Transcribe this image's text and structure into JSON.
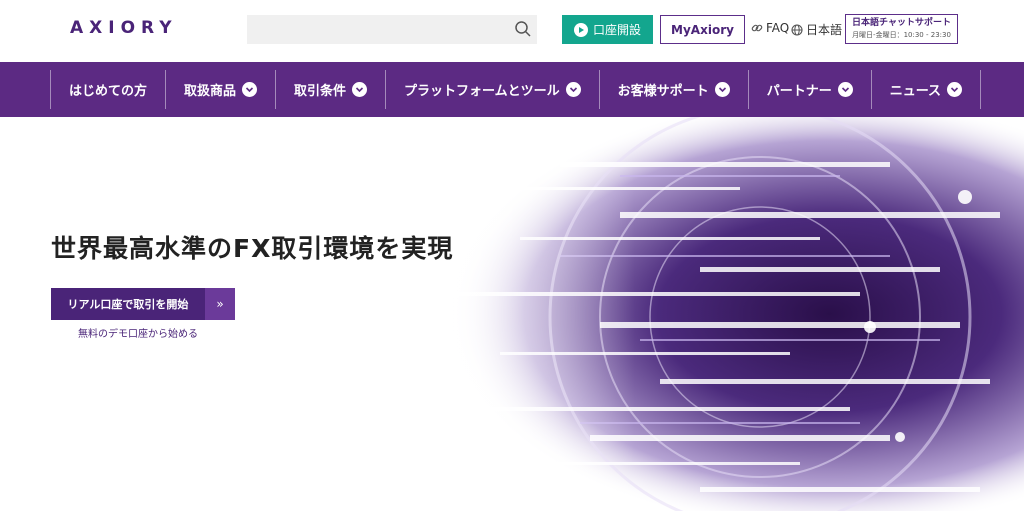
{
  "header": {
    "logo_text": "AXIORY",
    "search": {
      "placeholder": ""
    },
    "open_account_label": "口座開設",
    "my_axiory_label": "MyAxiory",
    "faq_label": "FAQ",
    "language_label": "日本語",
    "chat_support": {
      "title": "日本語チャットサポート",
      "hours": "月曜日-金曜日：10:30 - 23:30"
    }
  },
  "nav": {
    "items": [
      {
        "label": "はじめての方",
        "has_dropdown": false
      },
      {
        "label": "取扱商品",
        "has_dropdown": true
      },
      {
        "label": "取引条件",
        "has_dropdown": true
      },
      {
        "label": "プラットフォームとツール",
        "has_dropdown": true
      },
      {
        "label": "お客様サポート",
        "has_dropdown": true
      },
      {
        "label": "パートナー",
        "has_dropdown": true
      },
      {
        "label": "ニュース",
        "has_dropdown": true
      }
    ]
  },
  "hero": {
    "title": "世界最高水準のFX取引環境を実現",
    "cta_label": "リアル口座で取引を開始",
    "cta_arrow": "»",
    "demo_link": "無料のデモ口座から始める"
  },
  "colors": {
    "brand_purple": "#5c2a83",
    "dark_purple": "#4a2478",
    "accent_green": "#13a68e"
  },
  "icons": [
    "search-icon",
    "play-icon",
    "link-icon",
    "globe-icon",
    "chevron-down-icon"
  ]
}
